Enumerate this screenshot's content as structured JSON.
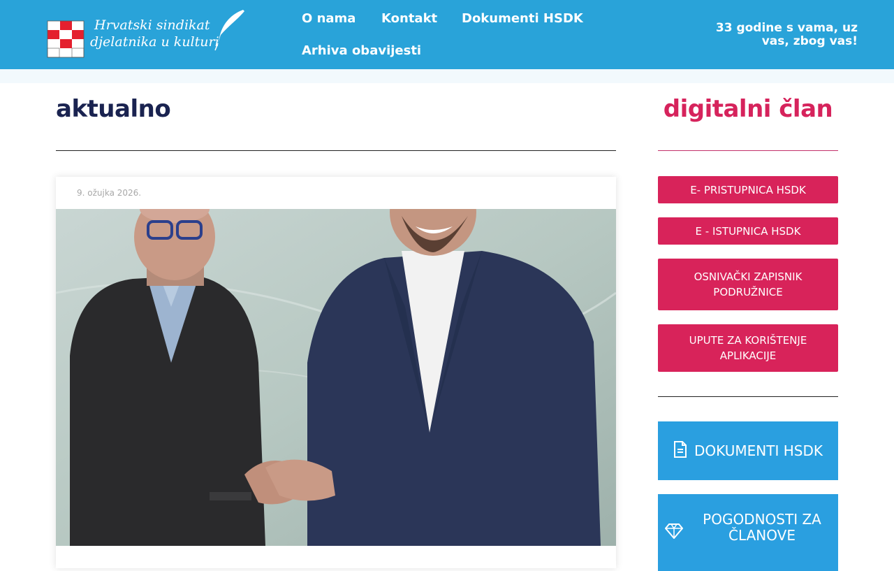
{
  "header": {
    "logo_line1": "Hrvatski sindikat",
    "logo_line2": "djelatnika u kulturi",
    "nav": [
      "O nama",
      "Kontakt",
      "Dokumenti HSDK",
      "Arhiva obavijesti"
    ],
    "tagline": "33 godine s vama, uz vas, zbog vas!"
  },
  "main": {
    "title": "aktualno",
    "post": {
      "date": "9. ožujka 2026."
    }
  },
  "sidebar": {
    "title": "digitalni član",
    "buttons": [
      "E- PRISTUPNICA HSDK",
      "E - ISTUPNICA HSDK",
      "OSNIVAČKI ZAPISNIK PODRUŽNICE",
      "UPUTE ZA KORIŠTENJE APLIKACIJE"
    ],
    "blue_buttons": [
      {
        "label": "DOKUMENTI HSDK",
        "icon": "document-icon"
      },
      {
        "label": "POGODNOSTI ZA ČLANOVE",
        "icon": "diamond-icon"
      }
    ]
  },
  "colors": {
    "header": "#29a3d9",
    "pink": "#d8235a",
    "blue": "#2a9fe0",
    "navy": "#1a2350"
  }
}
